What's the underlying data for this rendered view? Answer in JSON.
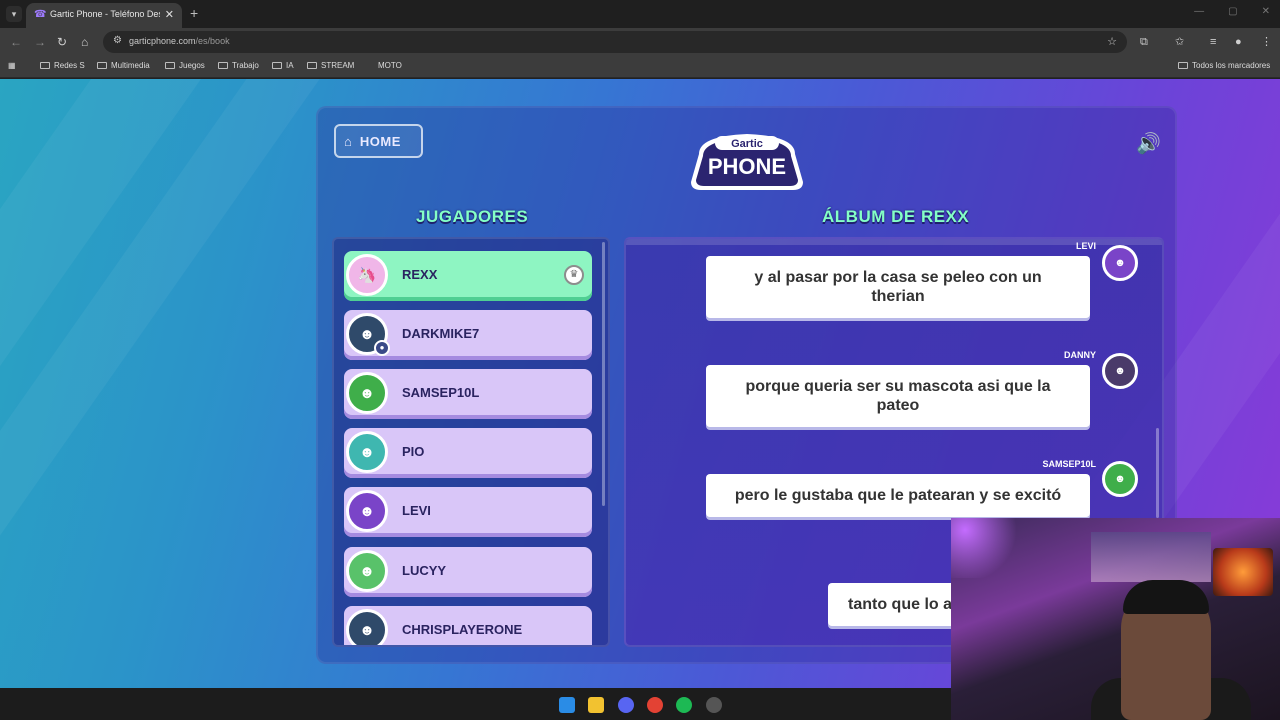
{
  "browser": {
    "tab_title": "Gartic Phone - Teléfono Descon",
    "url_host": "garticphone.com",
    "url_path": "/es/book",
    "bookmarks": [
      "Redes S",
      "Multimedia",
      "Juegos",
      "Trabajo",
      "IA",
      "STREAM",
      "MOTO"
    ],
    "all_bookmarks": "Todos los marcadores"
  },
  "game": {
    "home_label": "HOME",
    "logo_top": "Gartic",
    "logo_bottom": "PHONE",
    "players_title": "JUGADORES",
    "album_title": "ÁLBUM DE REXX",
    "players": [
      {
        "name": "REXX",
        "avatar": "unicorn-avatar",
        "color": "#f0b6e8",
        "host": true
      },
      {
        "name": "DARKMIKE7",
        "avatar": "masked-avatar",
        "color": "#2f4a6a"
      },
      {
        "name": "SAMSEP10L",
        "avatar": "green-monster-avatar",
        "color": "#3fae4a"
      },
      {
        "name": "PIO",
        "avatar": "glasses-avatar",
        "color": "#3fb7b0"
      },
      {
        "name": "LEVI",
        "avatar": "purple-bird-avatar",
        "color": "#7a44c8"
      },
      {
        "name": "LUCYY",
        "avatar": "alien-avatar",
        "color": "#59c26a"
      },
      {
        "name": "CHRISPLAYERONE",
        "avatar": "masked-avatar",
        "color": "#2f4a6a"
      }
    ],
    "album": [
      {
        "author": "LEVI",
        "text": "y al pasar por la casa se peleo con un therian",
        "color": "#7a44c8"
      },
      {
        "author": "DANNY",
        "text": "porque queria ser su mascota asi que la pateo",
        "color": "#4a3a6a"
      },
      {
        "author": "SAMSEP10L",
        "text": "pero le gustaba que le patearan y se excitó",
        "color": "#3fae4a"
      },
      {
        "author": "",
        "text": "tanto que lo a",
        "color": ""
      }
    ]
  }
}
